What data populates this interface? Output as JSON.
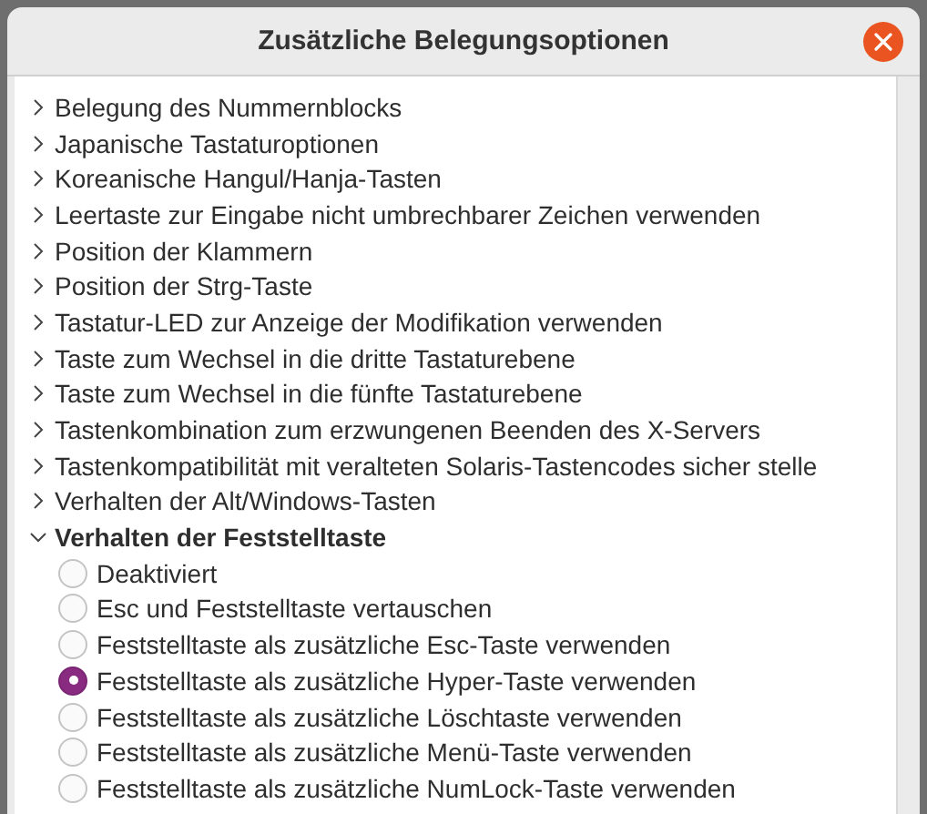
{
  "window": {
    "title": "Zusätzliche Belegungsoptionen"
  },
  "groups": [
    {
      "label": "Belegung des Nummernblocks",
      "expanded": false
    },
    {
      "label": "Japanische Tastaturoptionen",
      "expanded": false
    },
    {
      "label": "Koreanische Hangul/Hanja-Tasten",
      "expanded": false
    },
    {
      "label": "Leertaste zur Eingabe nicht umbrechbarer Zeichen verwenden",
      "expanded": false
    },
    {
      "label": "Position der Klammern",
      "expanded": false
    },
    {
      "label": "Position der Strg-Taste",
      "expanded": false
    },
    {
      "label": "Tastatur-LED zur Anzeige der Modifikation verwenden",
      "expanded": false
    },
    {
      "label": "Taste zum Wechsel in die dritte Tastaturebene",
      "expanded": false
    },
    {
      "label": "Taste zum Wechsel in die fünfte Tastaturebene",
      "expanded": false
    },
    {
      "label": "Tastenkombination zum erzwungenen Beenden des X-Servers",
      "expanded": false
    },
    {
      "label": "Tastenkompatibilität mit veralteten Solaris-Tastencodes sicher stelle",
      "expanded": false
    },
    {
      "label": "Verhalten der Alt/Windows-Tasten",
      "expanded": false
    },
    {
      "label": "Verhalten der Feststelltaste",
      "expanded": true,
      "children": [
        {
          "label": "Deaktiviert",
          "selected": false
        },
        {
          "label": "Esc und Feststelltaste vertauschen",
          "selected": false
        },
        {
          "label": "Feststelltaste als zusätzliche Esc-Taste verwenden",
          "selected": false
        },
        {
          "label": "Feststelltaste als zusätzliche Hyper-Taste verwenden",
          "selected": true
        },
        {
          "label": "Feststelltaste als zusätzliche Löschtaste verwenden",
          "selected": false
        },
        {
          "label": "Feststelltaste als zusätzliche Menü-Taste verwenden",
          "selected": false
        },
        {
          "label": "Feststelltaste als zusätzliche NumLock-Taste verwenden",
          "selected": false
        }
      ]
    }
  ]
}
